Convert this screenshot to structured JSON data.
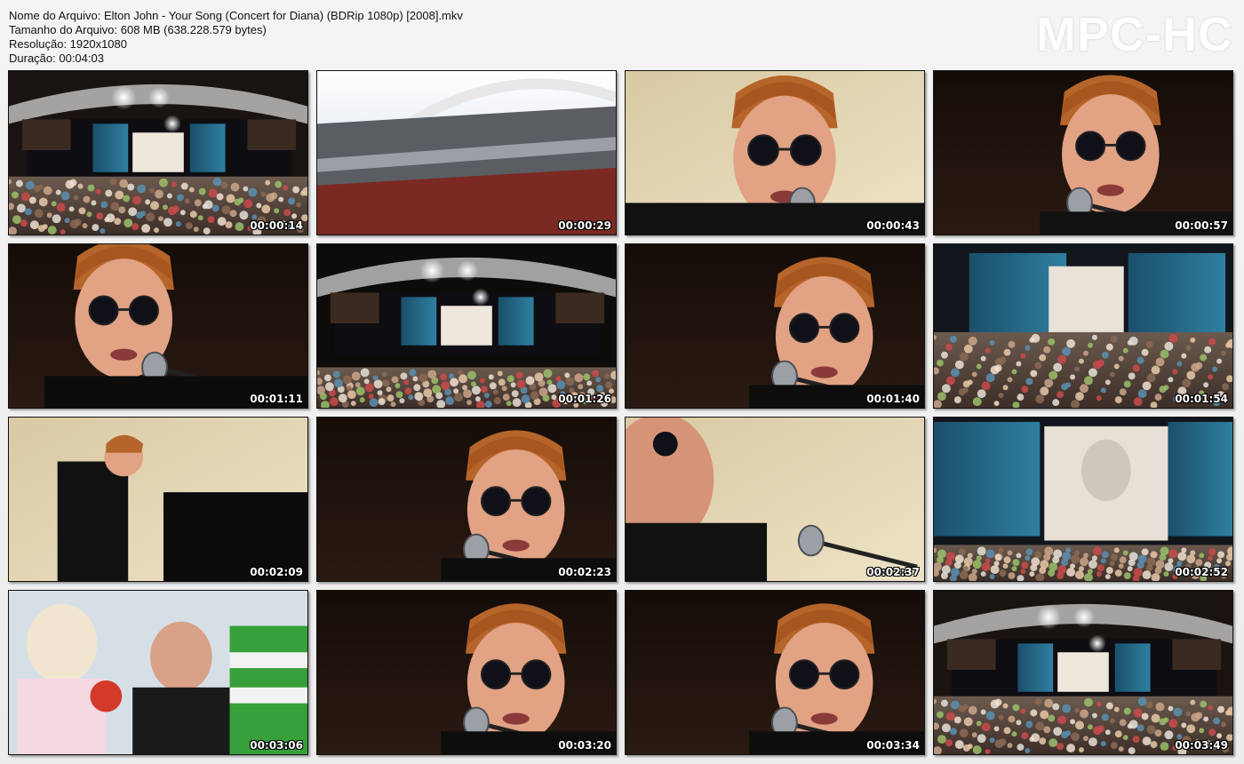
{
  "header": {
    "filename": "Nome do Arquivo: Elton John - Your Song (Concert for Diana) (BDRip 1080p) [2008].mkv",
    "filesize": "Tamanho do Arquivo: 608 MB (638.228.579 bytes)",
    "resolution": "Resolução: 1920x1080",
    "duration": "Duração: 00:04:03"
  },
  "logo": "MPC-HC",
  "thumbnails": [
    {
      "time": "00:00:14",
      "scene": "stage-crowd"
    },
    {
      "time": "00:00:29",
      "scene": "stadium-roof"
    },
    {
      "time": "00:00:43",
      "scene": "singer-closeup-bright"
    },
    {
      "time": "00:00:57",
      "scene": "singer-closeup-dark"
    },
    {
      "time": "00:01:11",
      "scene": "singer-smile"
    },
    {
      "time": "00:01:26",
      "scene": "stage-wide"
    },
    {
      "time": "00:01:40",
      "scene": "singer-mic"
    },
    {
      "time": "00:01:54",
      "scene": "screen-crowd"
    },
    {
      "time": "00:02:09",
      "scene": "piano"
    },
    {
      "time": "00:02:23",
      "scene": "singer-mic"
    },
    {
      "time": "00:02:37",
      "scene": "singer-profile"
    },
    {
      "time": "00:02:52",
      "scene": "screen-portrait"
    },
    {
      "time": "00:03:06",
      "scene": "audience"
    },
    {
      "time": "00:03:20",
      "scene": "singer-mic"
    },
    {
      "time": "00:03:34",
      "scene": "singer-mic"
    },
    {
      "time": "00:03:49",
      "scene": "stage-crowd"
    }
  ]
}
